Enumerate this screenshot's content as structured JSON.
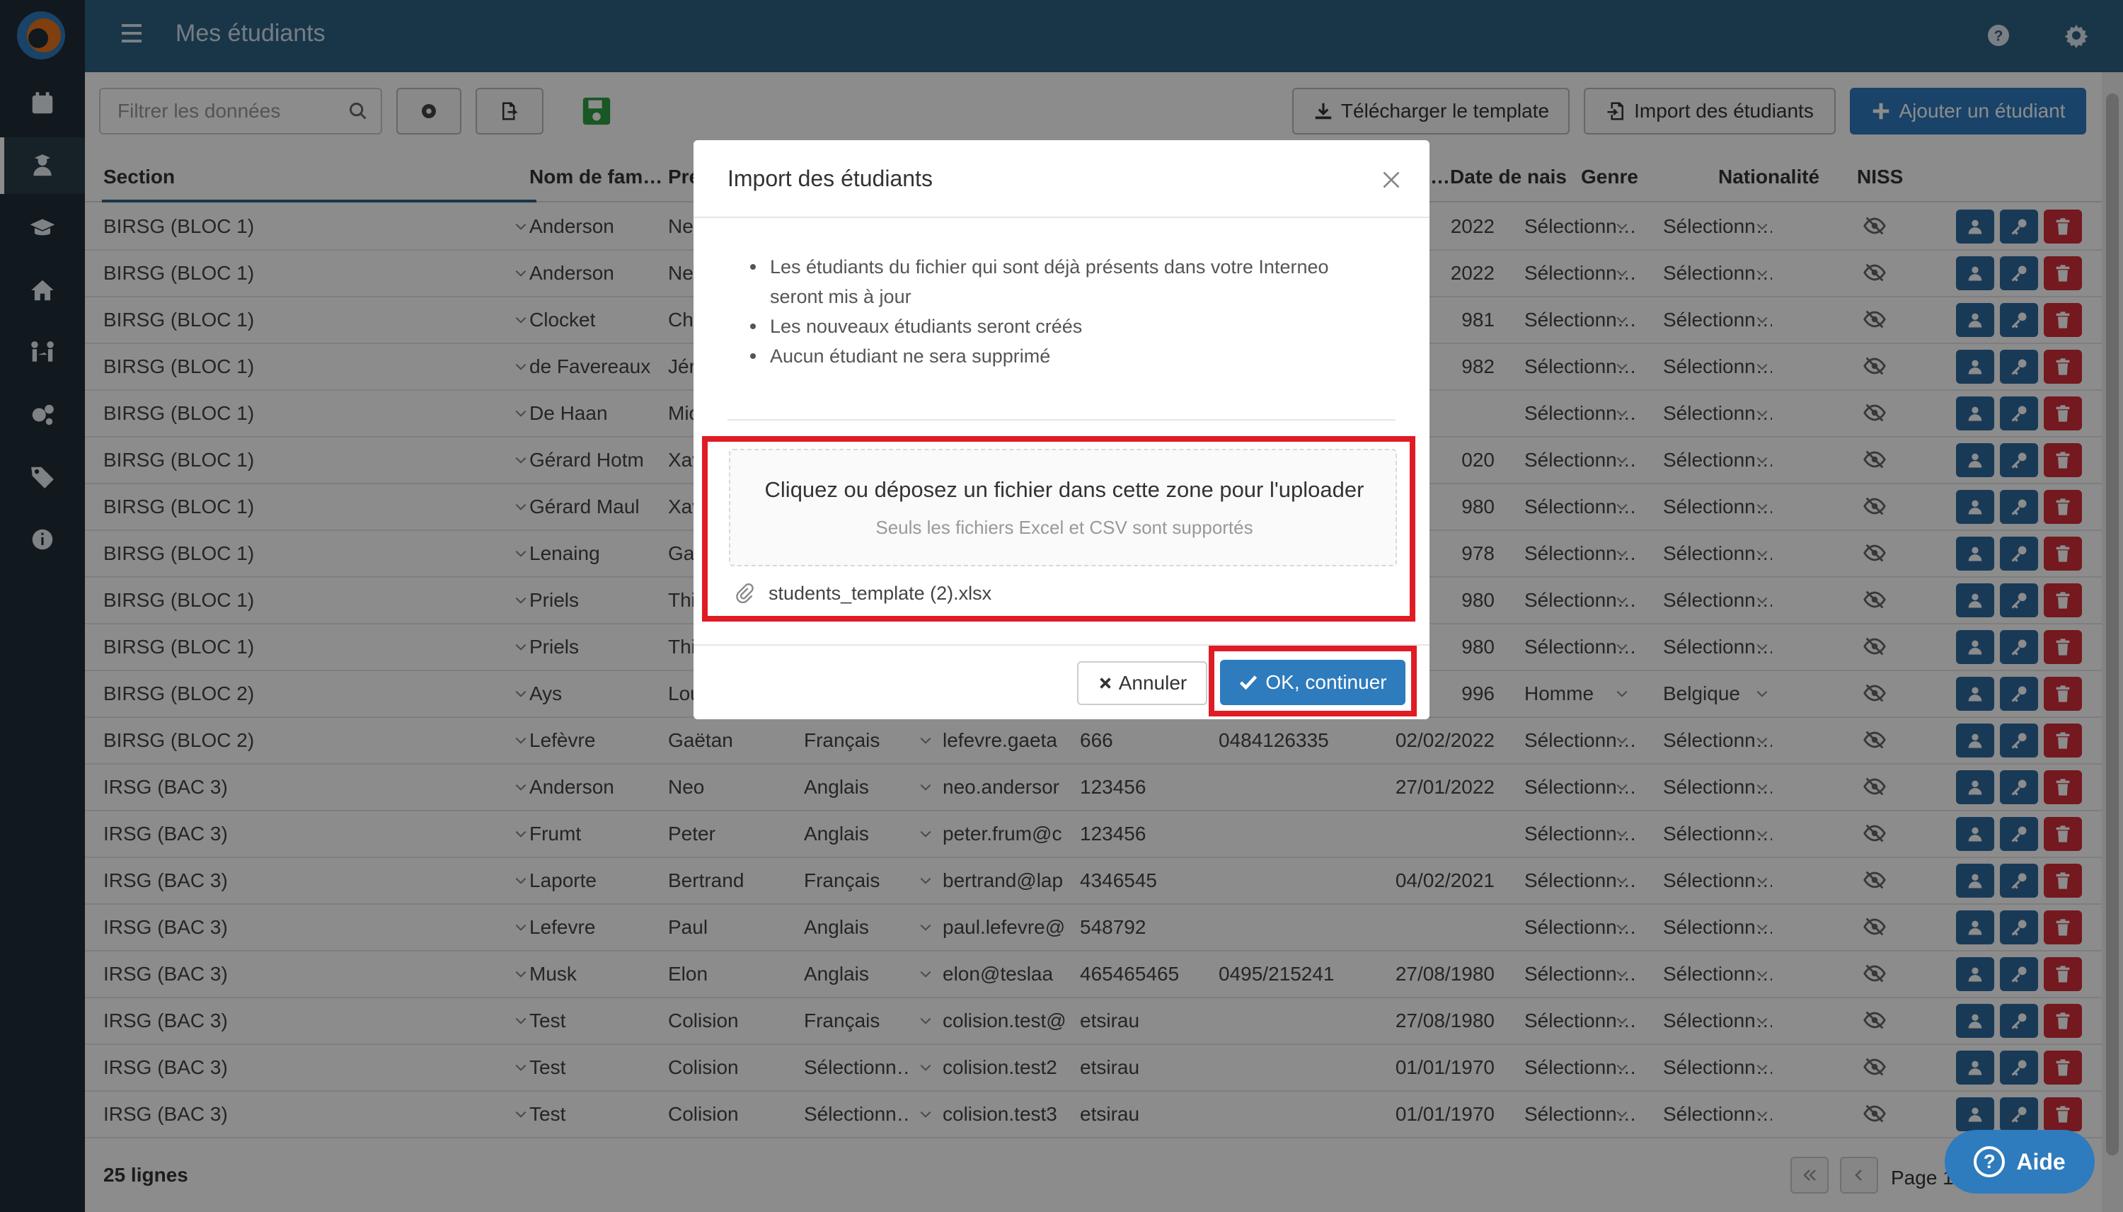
{
  "header": {
    "title": "Mes étudiants"
  },
  "sidebar": {
    "items": [
      {
        "icon": "calendar-icon"
      },
      {
        "icon": "student-icon",
        "active": true
      },
      {
        "icon": "graduation-cap-icon"
      },
      {
        "icon": "home-icon"
      },
      {
        "icon": "people-arrows-icon"
      },
      {
        "icon": "cogs-icon"
      },
      {
        "icon": "tags-icon"
      },
      {
        "icon": "info-icon"
      }
    ]
  },
  "toolbar": {
    "filter_placeholder": "Filtrer les données",
    "download_template": "Télécharger le template",
    "import_students": "Import des étudiants",
    "add_student": "Ajouter un étudiant"
  },
  "table": {
    "columns": [
      "Section",
      "Nom de fam…",
      "Pré",
      "Date de nais…",
      "Genre",
      "Nationalité",
      "NISS"
    ],
    "rows": [
      {
        "section": "BIRSG (BLOC 1)",
        "nom": "Anderson",
        "prenom": "Neo",
        "langue": "",
        "email": "",
        "tel": "",
        "mobile": "",
        "date": "2022",
        "genre": "Sélectionn…",
        "nat": "Sélectionn…"
      },
      {
        "section": "BIRSG (BLOC 1)",
        "nom": "Anderson",
        "prenom": "Neo",
        "langue": "",
        "email": "",
        "tel": "",
        "mobile": "",
        "date": "2022",
        "genre": "Sélectionn…",
        "nat": "Sélectionn…"
      },
      {
        "section": "BIRSG (BLOC 1)",
        "nom": "Clocket",
        "prenom": "Chr",
        "langue": "",
        "email": "",
        "tel": "",
        "mobile": "",
        "date": "981",
        "genre": "Sélectionn…",
        "nat": "Sélectionn…"
      },
      {
        "section": "BIRSG (BLOC 1)",
        "nom": "de Favereaux",
        "prenom": "Jér",
        "langue": "",
        "email": "",
        "tel": "",
        "mobile": "",
        "date": "982",
        "genre": "Sélectionn…",
        "nat": "Sélectionn…"
      },
      {
        "section": "BIRSG (BLOC 1)",
        "nom": "De Haan",
        "prenom": "Mic",
        "langue": "",
        "email": "",
        "tel": "",
        "mobile": "",
        "date": "",
        "genre": "Sélectionn…",
        "nat": "Sélectionn…"
      },
      {
        "section": "BIRSG (BLOC 1)",
        "nom": "Gérard Hotm",
        "prenom": "Xav",
        "langue": "",
        "email": "",
        "tel": "",
        "mobile": "",
        "date": "020",
        "genre": "Sélectionn…",
        "nat": "Sélectionn…"
      },
      {
        "section": "BIRSG (BLOC 1)",
        "nom": "Gérard Maul",
        "prenom": "Xav",
        "langue": "",
        "email": "",
        "tel": "",
        "mobile": "",
        "date": "980",
        "genre": "Sélectionn…",
        "nat": "Sélectionn…"
      },
      {
        "section": "BIRSG (BLOC 1)",
        "nom": "Lenaing",
        "prenom": "Gae",
        "langue": "",
        "email": "",
        "tel": "",
        "mobile": "",
        "date": "978",
        "genre": "Sélectionn…",
        "nat": "Sélectionn…"
      },
      {
        "section": "BIRSG (BLOC 1)",
        "nom": "Priels",
        "prenom": "Thi",
        "langue": "",
        "email": "",
        "tel": "",
        "mobile": "",
        "date": "980",
        "genre": "Sélectionn…",
        "nat": "Sélectionn…"
      },
      {
        "section": "BIRSG (BLOC 1)",
        "nom": "Priels",
        "prenom": "Thi",
        "langue": "",
        "email": "",
        "tel": "",
        "mobile": "",
        "date": "980",
        "genre": "Sélectionn…",
        "nat": "Sélectionn…"
      },
      {
        "section": "BIRSG (BLOC 2)",
        "nom": "Ays",
        "prenom": "Lou",
        "langue": "",
        "email": "",
        "tel": "",
        "mobile": "",
        "date": "996",
        "genre": "Homme",
        "nat": "Belgique"
      },
      {
        "section": "BIRSG (BLOC 2)",
        "nom": "Lefèvre",
        "prenom": "Gaëtan",
        "langue": "Français",
        "email": "lefevre.gaeta",
        "tel": "666",
        "mobile": "0484126335",
        "date": "02/02/2022",
        "genre": "Sélectionn…",
        "nat": "Sélectionn…"
      },
      {
        "section": "IRSG (BAC 3)",
        "nom": "Anderson",
        "prenom": "Neo",
        "langue": "Anglais",
        "email": "neo.andersor",
        "tel": "123456",
        "mobile": "",
        "date": "27/01/2022",
        "genre": "Sélectionn…",
        "nat": "Sélectionn…"
      },
      {
        "section": "IRSG (BAC 3)",
        "nom": "Frumt",
        "prenom": "Peter",
        "langue": "Anglais",
        "email": "peter.frum@c",
        "tel": "123456",
        "mobile": "",
        "date": "",
        "genre": "Sélectionn…",
        "nat": "Sélectionn…"
      },
      {
        "section": "IRSG (BAC 3)",
        "nom": "Laporte",
        "prenom": "Bertrand",
        "langue": "Français",
        "email": "bertrand@lap",
        "tel": "4346545",
        "mobile": "",
        "date": "04/02/2021",
        "genre": "Sélectionn…",
        "nat": "Sélectionn…"
      },
      {
        "section": "IRSG (BAC 3)",
        "nom": "Lefevre",
        "prenom": "Paul",
        "langue": "Anglais",
        "email": "paul.lefevre@",
        "tel": "548792",
        "mobile": "",
        "date": "",
        "genre": "Sélectionn…",
        "nat": "Sélectionn…"
      },
      {
        "section": "IRSG (BAC 3)",
        "nom": "Musk",
        "prenom": "Elon",
        "langue": "Anglais",
        "email": "elon@teslaa",
        "tel": "465465465",
        "mobile": "0495/215241",
        "date": "27/08/1980",
        "genre": "Sélectionn…",
        "nat": "Sélectionn…"
      },
      {
        "section": "IRSG (BAC 3)",
        "nom": "Test",
        "prenom": "Colision",
        "langue": "Français",
        "email": "colision.test@",
        "tel": "etsirau",
        "mobile": "",
        "date": "27/08/1980",
        "genre": "Sélectionn…",
        "nat": "Sélectionn…"
      },
      {
        "section": "IRSG (BAC 3)",
        "nom": "Test",
        "prenom": "Colision",
        "langue": "Sélectionn…",
        "email": "colision.test2",
        "tel": "etsirau",
        "mobile": "",
        "date": "01/01/1970",
        "genre": "Sélectionn…",
        "nat": "Sélectionn…"
      },
      {
        "section": "IRSG (BAC 3)",
        "nom": "Test",
        "prenom": "Colision",
        "langue": "Sélectionn…",
        "email": "colision.test3",
        "tel": "etsirau",
        "mobile": "",
        "date": "01/01/1970",
        "genre": "Sélectionn…",
        "nat": "Sélectionn…"
      }
    ]
  },
  "footer": {
    "rows_count": "25 lignes",
    "page_label": "Page 1"
  },
  "modal": {
    "title": "Import des étudiants",
    "bullets": [
      "Les étudiants du fichier qui sont déjà présents dans votre Interneo seront mis à jour",
      "Les nouveaux étudiants seront créés",
      "Aucun étudiant ne sera supprimé"
    ],
    "dropzone_text": "Cliquez ou déposez un fichier dans cette zone pour l'uploader",
    "dropzone_hint": "Seuls les fichiers Excel et CSV sont supportés",
    "file_name": "students_template (2).xlsx",
    "cancel_label": "Annuler",
    "ok_label": "OK, continuer"
  },
  "help": {
    "label": "Aide"
  },
  "colors": {
    "header": "#2e6385",
    "sidebar": "#1f2d38",
    "primary": "#2e7bbd",
    "danger": "#d42f3a",
    "highlight": "#e01b24"
  }
}
